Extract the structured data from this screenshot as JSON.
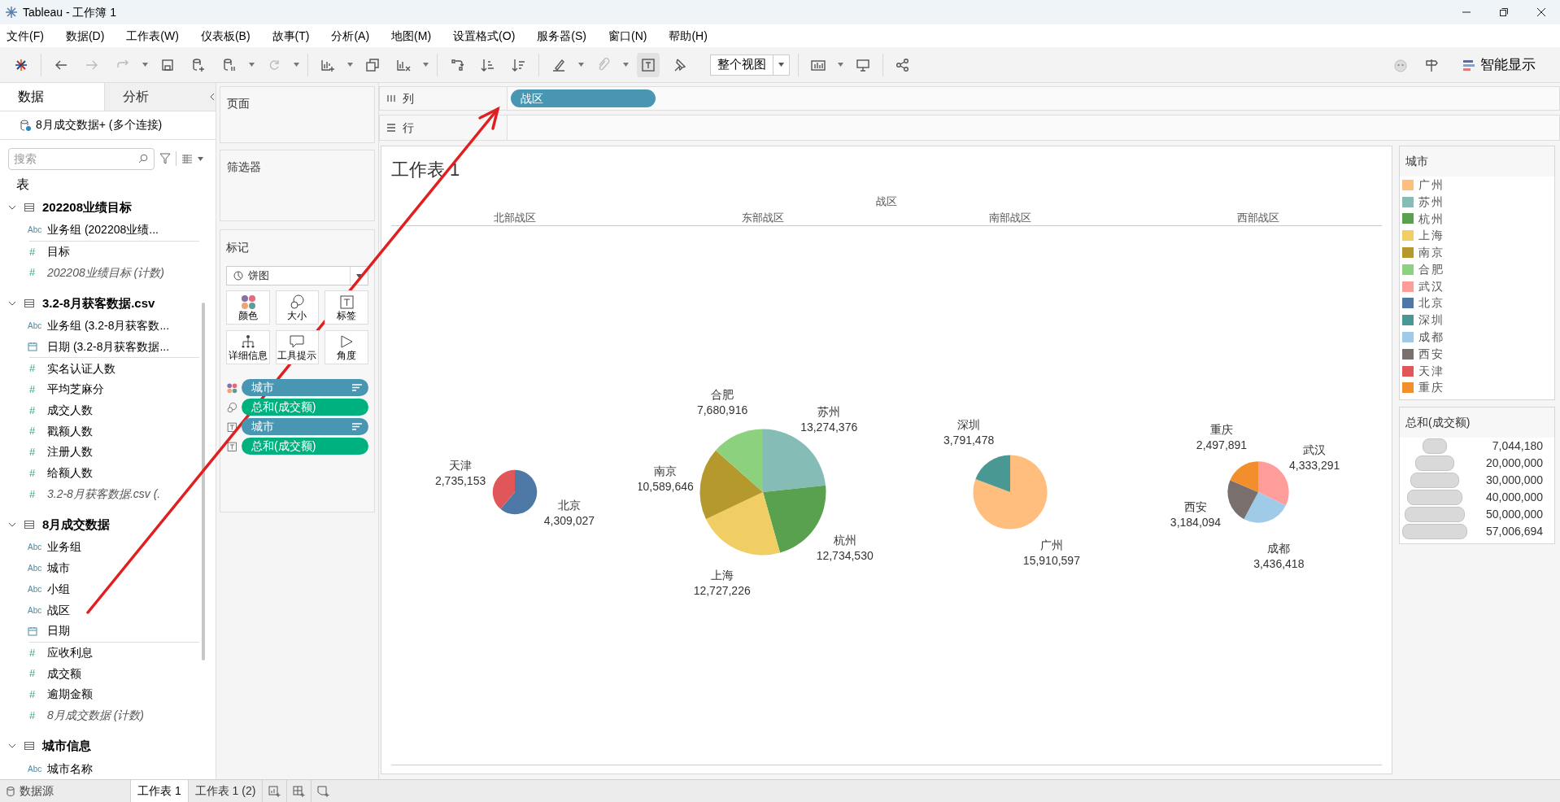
{
  "window": {
    "title": "Tableau - 工作簿 1"
  },
  "menu": [
    "文件(F)",
    "数据(D)",
    "工作表(W)",
    "仪表板(B)",
    "故事(T)",
    "分析(A)",
    "地图(M)",
    "设置格式(O)",
    "服务器(S)",
    "窗口(N)",
    "帮助(H)"
  ],
  "toolbar": {
    "fit_dropdown": "整个视图",
    "show_me": "智能显示"
  },
  "data_pane": {
    "tabs": [
      {
        "label": "数据",
        "selected": true
      },
      {
        "label": "分析",
        "selected": false
      }
    ],
    "connection": "8月成交数据+ (多个连接)",
    "search": {
      "placeholder": "搜索"
    },
    "tables_heading": "表",
    "tables": [
      {
        "name": "202208业绩目标",
        "expanded": true,
        "fields": [
          {
            "kind": "string",
            "icon": "Abc",
            "name": "业务组 (202208业绩...",
            "generated": false
          },
          {
            "kind": "number",
            "icon": "#",
            "name": "目标",
            "generated": false
          },
          {
            "kind": "number",
            "icon": "#",
            "name": "202208业绩目标 (计数)",
            "generated": true
          }
        ]
      },
      {
        "name": "3.2-8月获客数据.csv",
        "expanded": true,
        "fields": [
          {
            "kind": "string",
            "icon": "Abc",
            "name": "业务组 (3.2-8月获客数...",
            "generated": false
          },
          {
            "kind": "date",
            "name": "日期 (3.2-8月获客数据...",
            "generated": false
          },
          {
            "kind": "number",
            "icon": "#",
            "name": "实名认证人数",
            "generated": false
          },
          {
            "kind": "number",
            "icon": "#",
            "name": "平均芝麻分",
            "generated": false
          },
          {
            "kind": "number",
            "icon": "#",
            "name": "成交人数",
            "generated": false
          },
          {
            "kind": "number",
            "icon": "#",
            "name": "戳额人数",
            "generated": false
          },
          {
            "kind": "number",
            "icon": "#",
            "name": "注册人数",
            "generated": false
          },
          {
            "kind": "number",
            "icon": "#",
            "name": "给额人数",
            "generated": false
          },
          {
            "kind": "number",
            "icon": "#",
            "name": "3.2-8月获客数据.csv (.",
            "generated": true
          }
        ]
      },
      {
        "name": "8月成交数据",
        "expanded": true,
        "fields": [
          {
            "kind": "string",
            "icon": "Abc",
            "name": "业务组",
            "generated": false
          },
          {
            "kind": "string",
            "icon": "Abc",
            "name": "城市",
            "generated": false
          },
          {
            "kind": "string",
            "icon": "Abc",
            "name": "小组",
            "generated": false
          },
          {
            "kind": "string",
            "icon": "Abc",
            "name": "战区",
            "generated": false
          },
          {
            "kind": "date",
            "name": "日期",
            "generated": false
          },
          {
            "kind": "number",
            "icon": "#",
            "name": "应收利息",
            "generated": false
          },
          {
            "kind": "number",
            "icon": "#",
            "name": "成交额",
            "generated": false
          },
          {
            "kind": "number",
            "icon": "#",
            "name": "逾期金额",
            "generated": false
          },
          {
            "kind": "number",
            "icon": "#",
            "name": "8月成交数据 (计数)",
            "generated": true
          }
        ]
      },
      {
        "name": "城市信息",
        "expanded": true,
        "fields": [
          {
            "kind": "string",
            "icon": "Abc",
            "name": "城市名称",
            "generated": false
          }
        ]
      }
    ]
  },
  "cards": {
    "pages": "页面",
    "filters": "筛选器",
    "marks": {
      "title": "标记",
      "mark_type": "饼图",
      "buttons": [
        {
          "kind": "color",
          "label": "颜色"
        },
        {
          "kind": "size",
          "label": "大小"
        },
        {
          "kind": "label",
          "label": "标签"
        },
        {
          "kind": "detail",
          "label": "详细信息"
        },
        {
          "kind": "tooltip",
          "label": "工具提示"
        },
        {
          "kind": "angle",
          "label": "角度"
        }
      ],
      "pills": [
        {
          "kind": "color",
          "label": "城市",
          "color": "#4996b2",
          "sorted": true
        },
        {
          "kind": "size",
          "label": "总和(成交额)",
          "color": "#00b180",
          "sorted": false
        },
        {
          "kind": "label",
          "label": "城市",
          "color": "#4996b2",
          "sorted": true
        },
        {
          "kind": "label",
          "label": "总和(成交额)",
          "color": "#00b180",
          "sorted": false
        }
      ]
    }
  },
  "shelves": {
    "columns": {
      "label": "列",
      "pills": [
        "战区"
      ]
    },
    "rows": {
      "label": "行"
    }
  },
  "view": {
    "title": "工作表 1",
    "header_field": "战区",
    "panes": [
      {
        "label": "北部战区",
        "chart_data": {
          "type": "pie",
          "categories": [
            "北京",
            "天津"
          ],
          "values": [
            4309027,
            2735153
          ],
          "value_labels": [
            "4,309,027",
            "2,735,153"
          ],
          "colors": [
            "#4e79a7",
            "#e15759"
          ],
          "data_labels": true
        }
      },
      {
        "label": "东部战区",
        "chart_data": {
          "type": "pie",
          "categories": [
            "苏州",
            "杭州",
            "上海",
            "南京",
            "合肥"
          ],
          "values": [
            13274376,
            12734530,
            12727226,
            10589646,
            7680916
          ],
          "value_labels": [
            "13,274,376",
            "12,734,530",
            "12,727,226",
            "10,589,646",
            "7,680,916"
          ],
          "colors": [
            "#86bcb6",
            "#59a14f",
            "#f1ce63",
            "#b6992d",
            "#8cd17d"
          ],
          "data_labels": true
        }
      },
      {
        "label": "南部战区",
        "chart_data": {
          "type": "pie",
          "categories": [
            "广州",
            "深圳"
          ],
          "values": [
            15910597,
            3791478
          ],
          "value_labels": [
            "15,910,597",
            "3,791,478"
          ],
          "colors": [
            "#ffbe7d",
            "#499894"
          ],
          "data_labels": true
        }
      },
      {
        "label": "西部战区",
        "chart_data": {
          "type": "pie",
          "categories": [
            "武汉",
            "成都",
            "西安",
            "重庆"
          ],
          "values": [
            4333291,
            3436418,
            3184094,
            2497891
          ],
          "value_labels": [
            "4,333,291",
            "3,436,418",
            "3,184,094",
            "2,497,891"
          ],
          "colors": [
            "#ff9d9a",
            "#a0cbe8",
            "#79706e",
            "#f28e2b"
          ],
          "data_labels": true
        }
      }
    ]
  },
  "legends": {
    "color": {
      "title": "城市",
      "items": [
        {
          "label": "广州",
          "color": "#ffbe7d"
        },
        {
          "label": "苏州",
          "color": "#86bcb6"
        },
        {
          "label": "杭州",
          "color": "#59a14f"
        },
        {
          "label": "上海",
          "color": "#f1ce63"
        },
        {
          "label": "南京",
          "color": "#b6992d"
        },
        {
          "label": "合肥",
          "color": "#8cd17d"
        },
        {
          "label": "武汉",
          "color": "#ff9d9a"
        },
        {
          "label": "北京",
          "color": "#4e79a7"
        },
        {
          "label": "深圳",
          "color": "#499894"
        },
        {
          "label": "成都",
          "color": "#a0cbe8"
        },
        {
          "label": "西安",
          "color": "#79706e"
        },
        {
          "label": "天津",
          "color": "#e15759"
        },
        {
          "label": "重庆",
          "color": "#f28e2b"
        }
      ]
    },
    "size": {
      "title": "总和(成交额)",
      "items": [
        "7,044,180",
        "20,000,000",
        "30,000,000",
        "40,000,000",
        "50,000,000",
        "57,006,694"
      ]
    }
  },
  "bottom_bar": {
    "data_source": "数据源",
    "sheets": [
      {
        "label": "工作表 1",
        "selected": true
      },
      {
        "label": "工作表 1 (2)",
        "selected": false
      }
    ]
  }
}
